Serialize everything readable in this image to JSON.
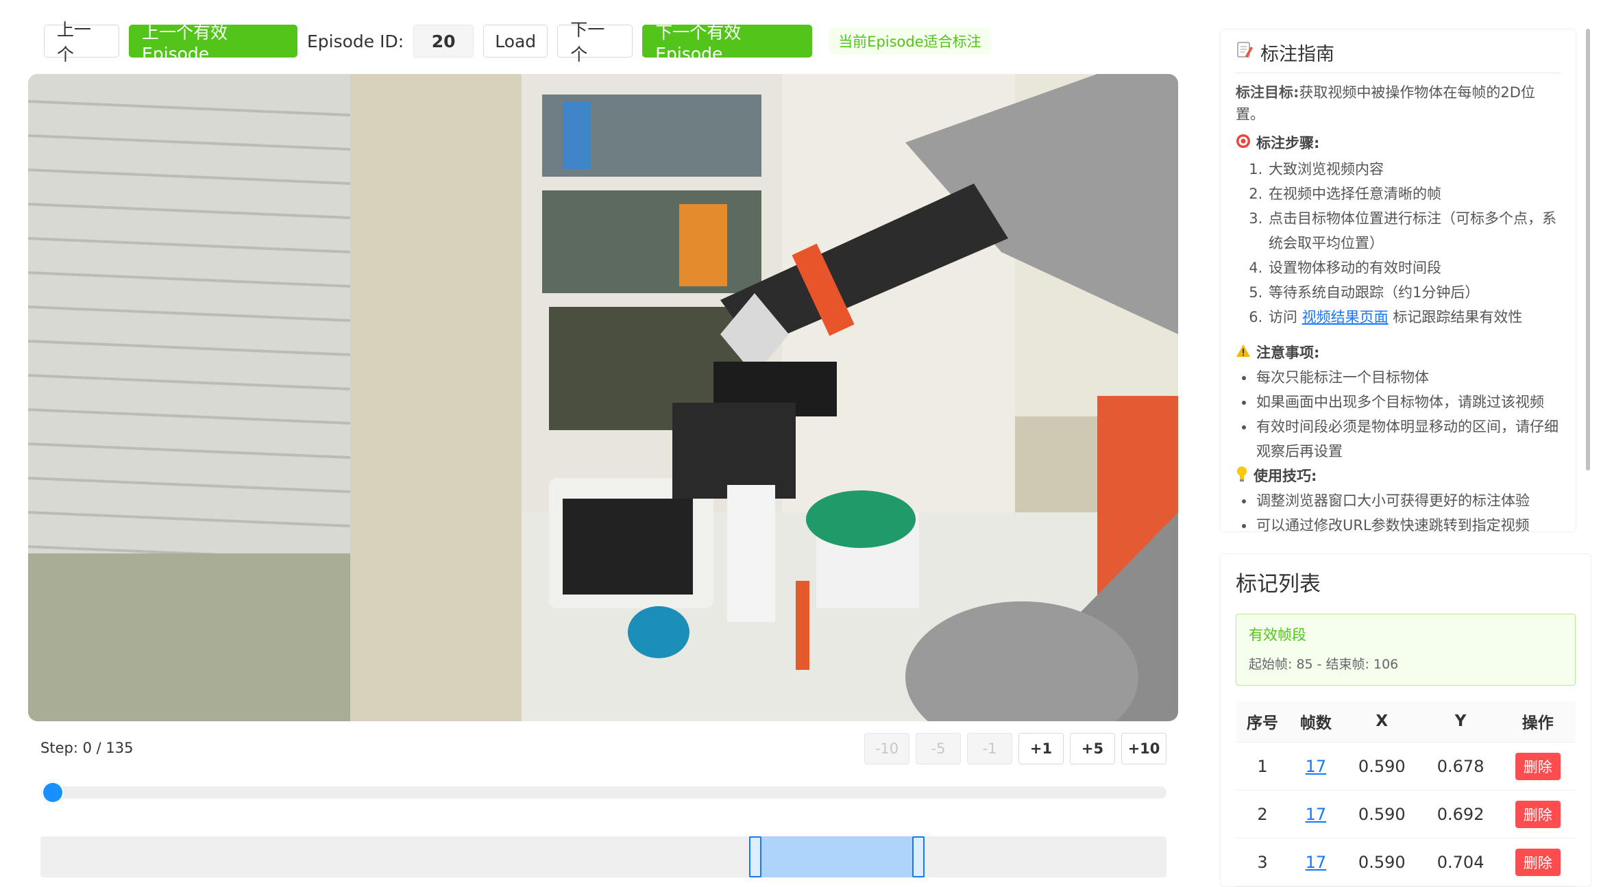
{
  "toolbar": {
    "prev": "上一个",
    "prev_valid": "上一个有效Episode",
    "episode_label": "Episode ID:",
    "episode_id": "20",
    "load": "Load",
    "next": "下一个",
    "next_valid": "下一个有效Episode",
    "status": "当前Episode适合标注",
    "accent_color": "#52c41a"
  },
  "video": {
    "step_text": "Step: 0 / 135",
    "current_step": 0,
    "total_steps": 135,
    "step_buttons": [
      {
        "label": "-10",
        "enabled": false
      },
      {
        "label": "-5",
        "enabled": false
      },
      {
        "label": "-1",
        "enabled": false
      },
      {
        "label": "+1",
        "enabled": true
      },
      {
        "label": "+5",
        "enabled": true
      },
      {
        "label": "+10",
        "enabled": true
      }
    ],
    "valid_range": {
      "start": 85,
      "end": 106
    }
  },
  "guide": {
    "title": "标注指南",
    "goal_label": "标注目标:",
    "goal_text": "获取视频中被操作物体在每帧的2D位置。",
    "steps_title": "标注步骤:",
    "steps": [
      "大致浏览视频内容",
      "在视频中选择任意清晰的帧",
      "点击目标物体位置进行标注（可标多个点，系统会取平均位置）",
      "设置物体移动的有效时间段",
      "等待系统自动跟踪（约1分钟后）"
    ],
    "step6_prefix": "访问",
    "step6_link": "视频结果页面",
    "step6_suffix": "标记跟踪结果有效性",
    "notes_title": "注意事项:",
    "notes": [
      "每次只能标注一个目标物体",
      "如果画面中出现多个目标物体，请跳过该视频",
      "有效时间段必须是物体明显移动的区间，请仔细观察后再设置"
    ],
    "tips_title": "使用技巧:",
    "tips": [
      "调整浏览器窗口大小可获得更好的标注体验",
      "可以通过修改URL参数快速跳转到指定视频"
    ]
  },
  "markers": {
    "title": "标记列表",
    "segment_title": "有效帧段",
    "segment_range": "起始帧: 85 - 结束帧: 106",
    "columns": [
      "序号",
      "帧数",
      "X",
      "Y",
      "操作"
    ],
    "rows": [
      {
        "index": "1",
        "frame": "17",
        "x": "0.590",
        "y": "0.678",
        "action": "删除"
      },
      {
        "index": "2",
        "frame": "17",
        "x": "0.590",
        "y": "0.692",
        "action": "删除"
      },
      {
        "index": "3",
        "frame": "17",
        "x": "0.590",
        "y": "0.704",
        "action": "删除"
      }
    ]
  }
}
